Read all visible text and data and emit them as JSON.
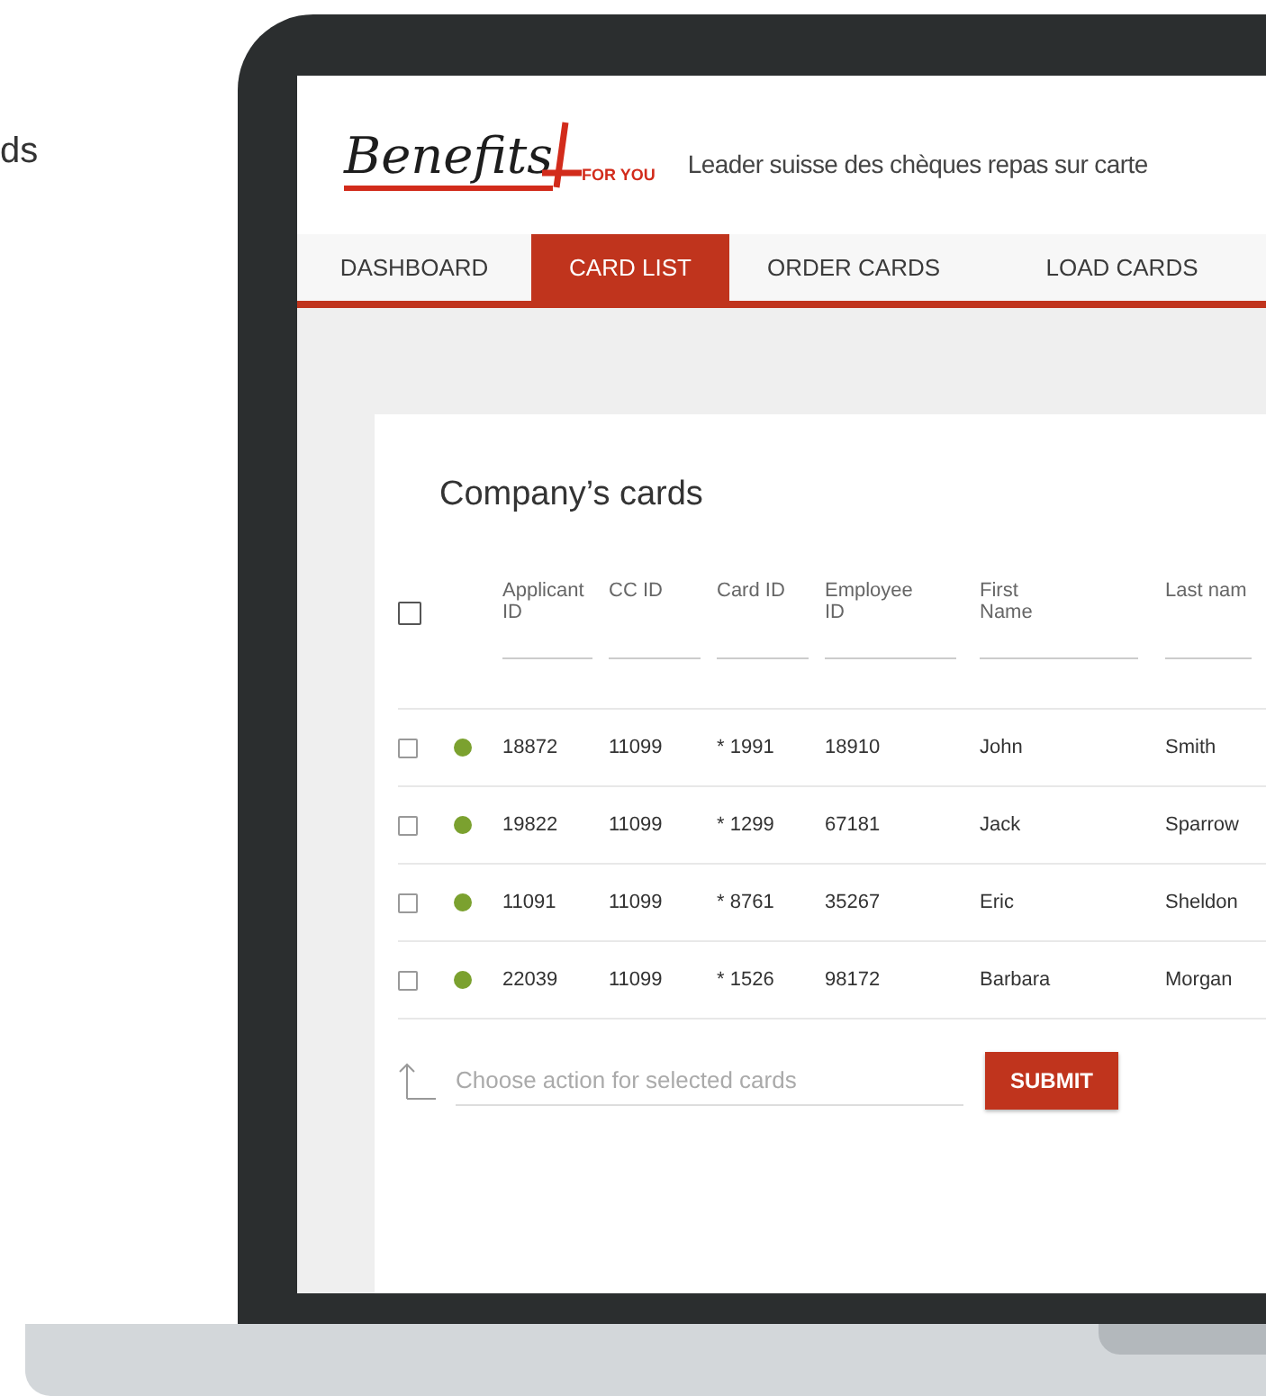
{
  "side_text": "ds",
  "header": {
    "logo": {
      "wordmark": "Benefits",
      "suffix": "FOR YOU"
    },
    "tagline": "Leader suisse des chèques repas sur carte"
  },
  "tabs": [
    {
      "label": "DASHBOARD",
      "selected": false
    },
    {
      "label": "CARD LIST",
      "selected": true
    },
    {
      "label": "ORDER CARDS",
      "selected": false
    },
    {
      "label": "LOAD CARDS",
      "selected": false
    }
  ],
  "card": {
    "title": "Company’s cards",
    "table": {
      "select_all": {
        "checked": false
      },
      "columns": [
        "Applicant ID",
        "CC ID",
        "Card ID",
        "Employee ID",
        "First Name",
        "Last nam"
      ],
      "rows": [
        {
          "checked": false,
          "color": "#7ba12f",
          "cells": [
            "18872",
            "11099",
            "* 1991",
            "18910",
            "John",
            "Smith"
          ]
        },
        {
          "checked": false,
          "color": "#7ba12f",
          "cells": [
            "19822",
            "11099",
            "* 1299",
            "67181",
            "Jack",
            "Sparrow"
          ]
        },
        {
          "checked": false,
          "color": "#7ba12f",
          "cells": [
            "11091",
            "11099",
            "* 8761",
            "35267",
            "Eric",
            "Sheldon"
          ]
        },
        {
          "checked": false,
          "color": "#7ba12f",
          "cells": [
            "22039",
            "11099",
            "* 1526",
            "98172",
            "Barbara",
            "Morgan"
          ]
        }
      ]
    },
    "action": {
      "placeholder": "Choose action for selected cards",
      "button": "SUBMIT"
    }
  }
}
